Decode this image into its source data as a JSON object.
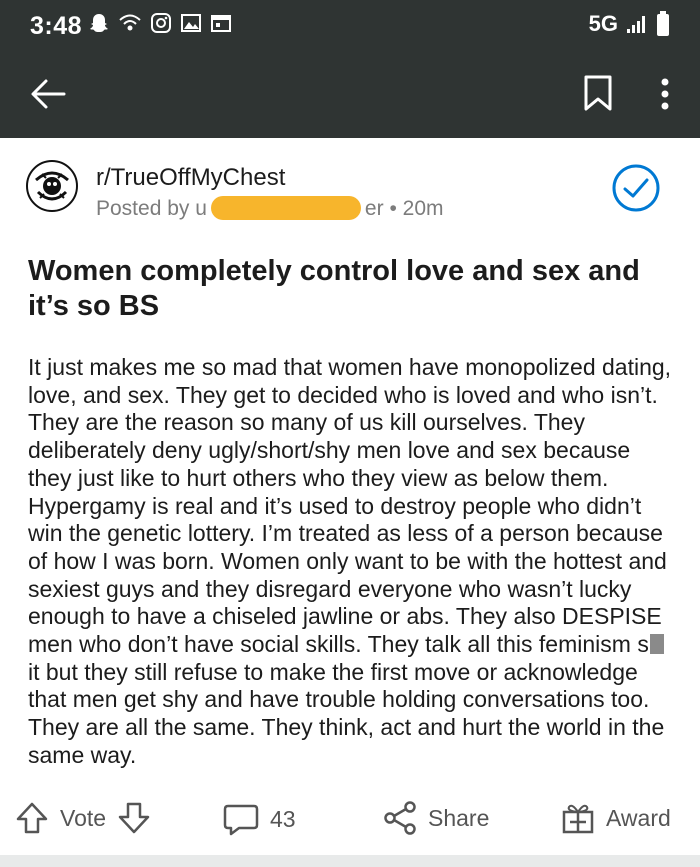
{
  "status_bar": {
    "time": "3:48",
    "network": "5G"
  },
  "post": {
    "subreddit": "r/TrueOffMyChest",
    "posted_by_prefix": "Posted by u",
    "username_visible_tail": "er",
    "separator": "•",
    "age": "20m",
    "title": "Women completely control love and sex and it’s so BS",
    "body_before_censor": "It just makes me so mad that women have monopolized dating, love, and sex. They get to decided who is loved and who isn’t. They are the reason so many of us kill ourselves. They deliberately deny ugly/short/shy men love and sex because they just like to hurt others who they view as below them. Hypergamy is real and it’s used to destroy people who didn’t win the genetic lottery. I’m treated as less of a person because of how I was born. Women only want to be with the hottest and sexiest guys and they disregard everyone who wasn’t lucky enough to have a chiseled jawline or abs. They also DESPISE men who don’t have social skills. They talk all this feminism s",
    "body_after_censor": "it but they still refuse to make the first move or acknowledge that men get shy and have trouble holding conversations too. They are all the same. They think, act and hurt the world in the same way."
  },
  "actions": {
    "vote_label": "Vote",
    "comment_count": "43",
    "share_label": "Share",
    "award_label": "Award"
  },
  "colors": {
    "status_bar_bg": "#2f3433",
    "accent": "#0079d3",
    "redaction": "#f7b52c"
  }
}
